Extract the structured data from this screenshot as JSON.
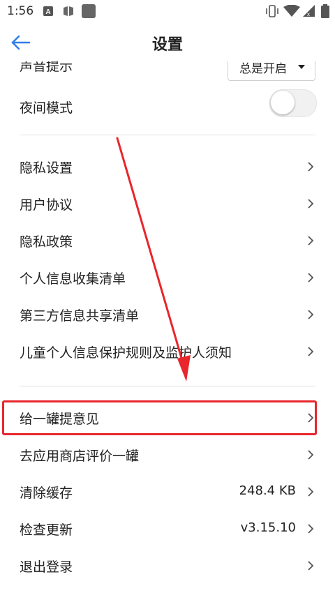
{
  "status_bar": {
    "time": "1:56",
    "left_icons": [
      "a-icon",
      "book-icon",
      "square-app-icon"
    ],
    "right_icons": [
      "vibrate-icon",
      "wifi-icon",
      "signal-icon",
      "battery-icon"
    ]
  },
  "app_bar": {
    "title": "设置",
    "back_icon": "back-arrow-icon"
  },
  "settings": {
    "sound": {
      "label": "声音提示",
      "value": "总是开启"
    },
    "night_mode": {
      "label": "夜间模式",
      "enabled": false
    },
    "group1": [
      {
        "label": "隐私设置"
      },
      {
        "label": "用户协议"
      },
      {
        "label": "隐私政策"
      },
      {
        "label": "个人信息收集清单"
      },
      {
        "label": "第三方信息共享清单"
      },
      {
        "label": "儿童个人信息保护规则及监护人须知"
      }
    ],
    "group2": [
      {
        "label": "给一罐提意见",
        "value": ""
      },
      {
        "label": "去应用商店评价一罐",
        "value": ""
      },
      {
        "label": "清除缓存",
        "value": "248.4 KB"
      },
      {
        "label": "检查更新",
        "value": "v3.15.10"
      },
      {
        "label": "退出登录",
        "value": ""
      }
    ]
  },
  "annotation": {
    "highlight_color": "#e8262c",
    "highlight_target": "给一罐提意见"
  },
  "colors": {
    "accent": "#2f7ee8",
    "divider": "#e2e2e2"
  }
}
